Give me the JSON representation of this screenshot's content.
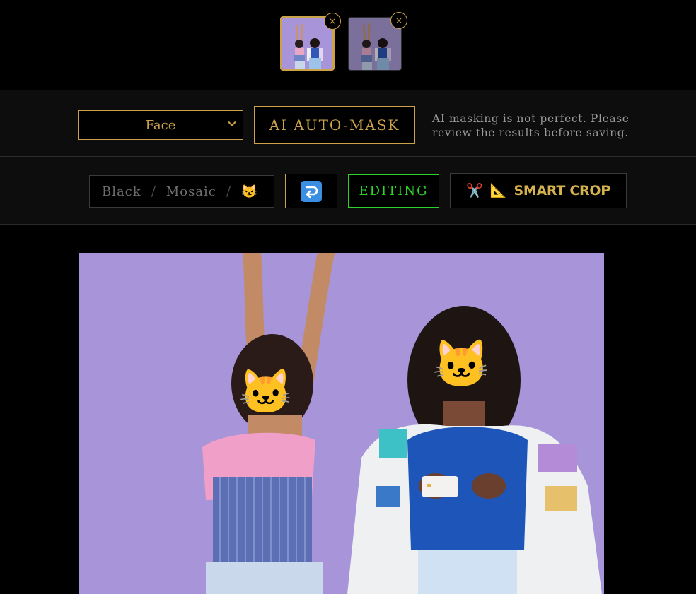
{
  "thumbnails": [
    {
      "remove_icon": "×",
      "selected": true
    },
    {
      "remove_icon": "×",
      "selected": false
    }
  ],
  "mask_toolbar": {
    "target_select": {
      "value": "Face",
      "options": [
        "Face"
      ]
    },
    "auto_mask_label": "AI AUTO-MASK",
    "note": "AI masking is not perfect. Please review the results before saving."
  },
  "edit_toolbar": {
    "modes": {
      "black": "Black",
      "separator": "/",
      "mosaic": "Mosaic",
      "emoji": "😼"
    },
    "undo_icon": "undo-arrow-icon",
    "editing_label": "EDITING",
    "smart_crop": {
      "scissors": "✂️",
      "ruler": "📐",
      "label": "SMART CROP"
    }
  },
  "canvas": {
    "face_masks": [
      "🐱",
      "🐱"
    ]
  },
  "colors": {
    "gold": "#c9a24a",
    "green": "#2bd32b",
    "undo_blue": "#3b8fe3",
    "photo_bg": "#a894d8"
  }
}
